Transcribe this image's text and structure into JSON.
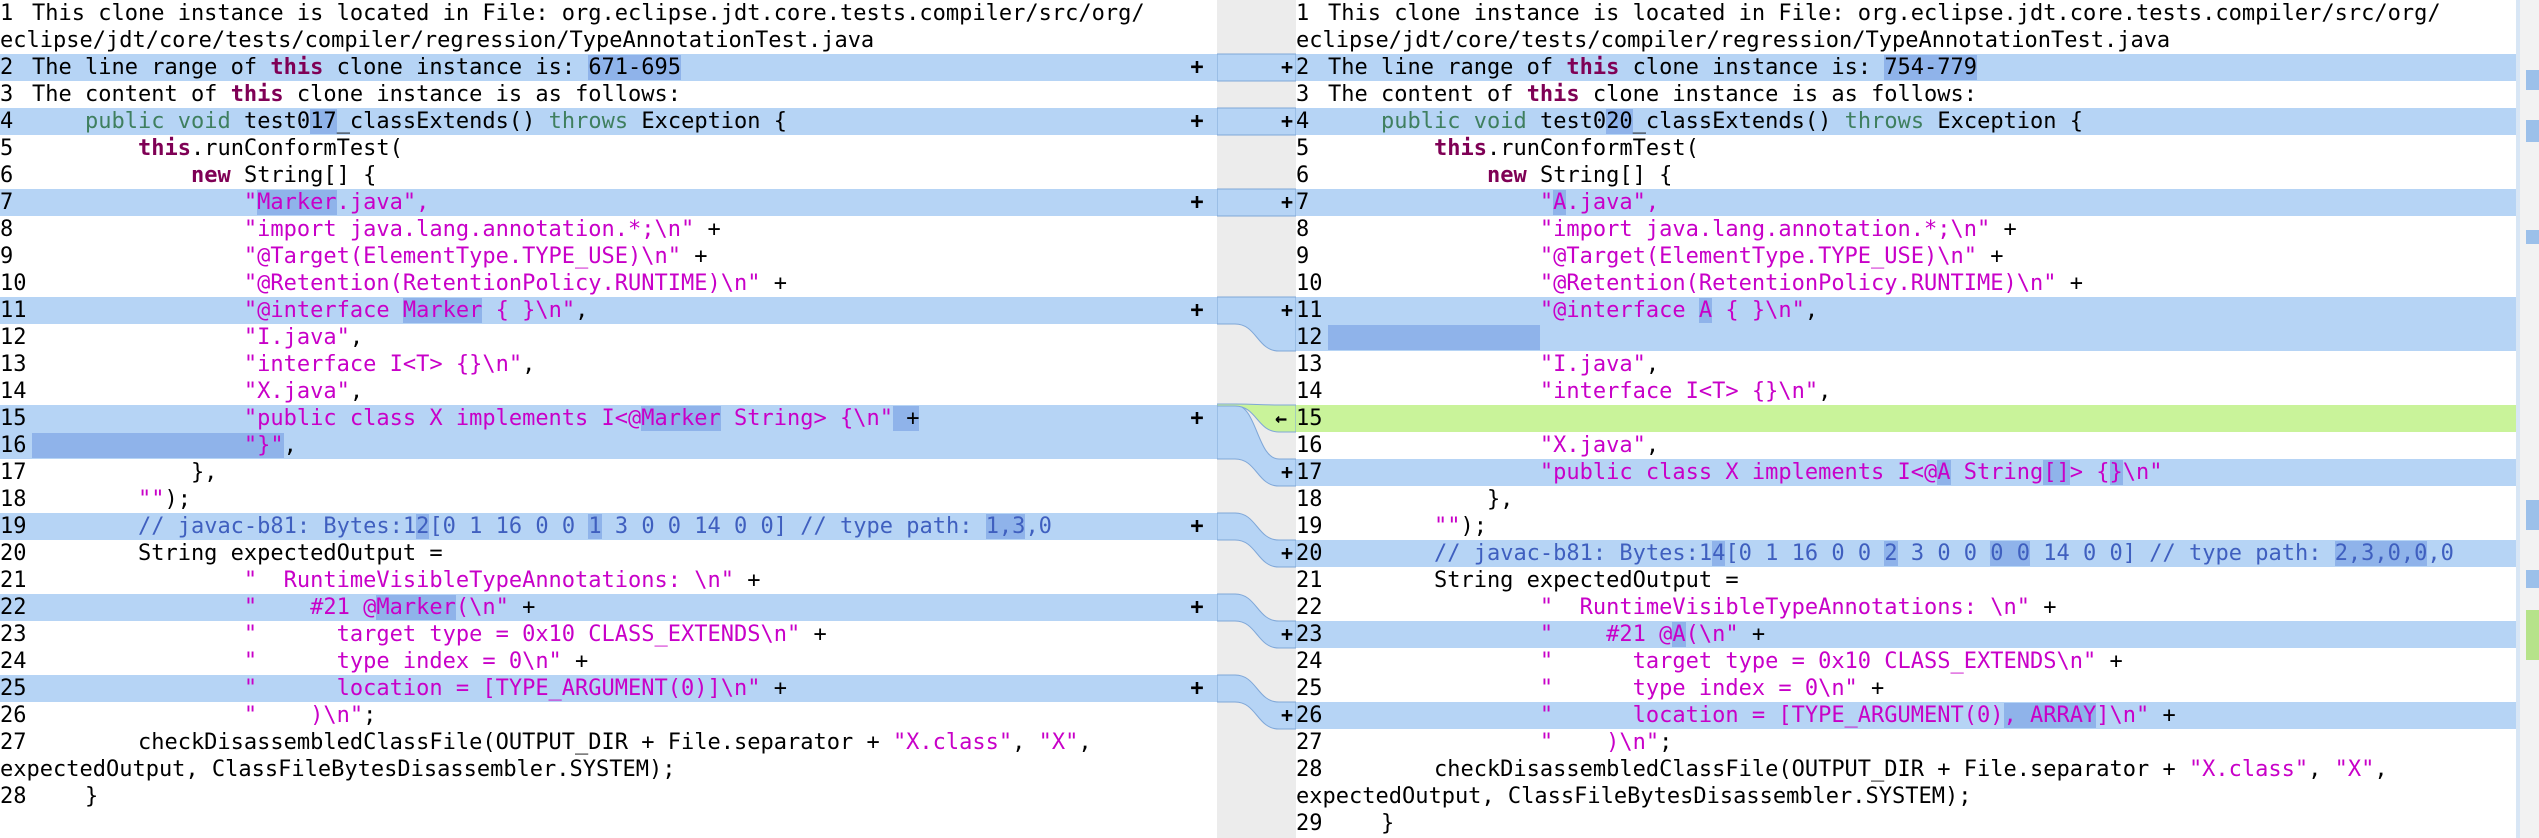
{
  "left": {
    "lines": [
      {
        "n": "1",
        "parts": [
          {
            "t": "This clone instance is located in File: org.eclipse.jdt.core.tests.compiler/src/org/"
          }
        ],
        "wrap": [
          {
            "t": "eclipse/jdt/core/tests/compiler/regression/TypeAnnotationTest.java"
          }
        ]
      },
      {
        "n": "2",
        "hl": true,
        "parts": [
          {
            "t": "The line range of "
          },
          {
            "t": "this",
            "c": "kw"
          },
          {
            "t": " clone instance is: "
          },
          {
            "t": "671-695",
            "c": "dh"
          }
        ]
      },
      {
        "n": "3",
        "parts": [
          {
            "t": "The content of "
          },
          {
            "t": "this",
            "c": "kw"
          },
          {
            "t": " clone instance is as follows:"
          }
        ]
      },
      {
        "n": "4",
        "hl": true,
        "parts": [
          {
            "t": "    "
          },
          {
            "t": "public",
            "c": "kg"
          },
          {
            "t": " "
          },
          {
            "t": "void",
            "c": "kg"
          },
          {
            "t": " test0"
          },
          {
            "t": "17",
            "c": "dh"
          },
          {
            "t": "_classExtends() "
          },
          {
            "t": "throws",
            "c": "kg"
          },
          {
            "t": " Exception {"
          }
        ]
      },
      {
        "n": "5",
        "parts": [
          {
            "t": "        "
          },
          {
            "t": "this",
            "c": "kw"
          },
          {
            "t": ".runConformTest("
          }
        ]
      },
      {
        "n": "6",
        "parts": [
          {
            "t": "            "
          },
          {
            "t": "new",
            "c": "kw"
          },
          {
            "t": " String[] {"
          }
        ]
      },
      {
        "n": "7",
        "hl": true,
        "parts": [
          {
            "t": "                "
          },
          {
            "t": "\"",
            "c": "str"
          },
          {
            "t": "Marker",
            "c": "str dh"
          },
          {
            "t": ".java\",",
            "c": "str"
          }
        ]
      },
      {
        "n": "8",
        "parts": [
          {
            "t": "                "
          },
          {
            "t": "\"import java.lang.annotation.*;\\n\"",
            "c": "str"
          },
          {
            "t": " +"
          }
        ]
      },
      {
        "n": "9",
        "parts": [
          {
            "t": "                "
          },
          {
            "t": "\"@Target(ElementType.TYPE_USE)\\n\"",
            "c": "str"
          },
          {
            "t": " +"
          }
        ]
      },
      {
        "n": "10",
        "parts": [
          {
            "t": "                "
          },
          {
            "t": "\"@Retention(RetentionPolicy.RUNTIME)\\n\"",
            "c": "str"
          },
          {
            "t": " +"
          }
        ]
      },
      {
        "n": "11",
        "hl": true,
        "parts": [
          {
            "t": "                "
          },
          {
            "t": "\"@interface ",
            "c": "str"
          },
          {
            "t": "Marker",
            "c": "str dh"
          },
          {
            "t": " { }\\n\"",
            "c": "str"
          },
          {
            "t": ","
          }
        ]
      },
      {
        "n": "12",
        "parts": [
          {
            "t": "                "
          },
          {
            "t": "\"I.java\"",
            "c": "str"
          },
          {
            "t": ","
          }
        ]
      },
      {
        "n": "13",
        "parts": [
          {
            "t": "                "
          },
          {
            "t": "\"interface I<T> {}\\n\"",
            "c": "str"
          },
          {
            "t": ","
          }
        ]
      },
      {
        "n": "14",
        "parts": [
          {
            "t": "                "
          },
          {
            "t": "\"X.java\"",
            "c": "str"
          },
          {
            "t": ","
          }
        ]
      },
      {
        "n": "15",
        "hl": true,
        "parts": [
          {
            "t": "                "
          },
          {
            "t": "\"public class X implements I<@",
            "c": "str"
          },
          {
            "t": "Marker",
            "c": "str dh"
          },
          {
            "t": " String> {\\n\"",
            "c": "str"
          },
          {
            "t": " +",
            "c": "dh"
          }
        ]
      },
      {
        "n": "16",
        "hl": true,
        "parts": [
          {
            "t": "                ",
            "c": "dh"
          },
          {
            "t": "\"}\"",
            "c": "str dh"
          },
          {
            "t": ","
          }
        ]
      },
      {
        "n": "17",
        "parts": [
          {
            "t": "            },"
          }
        ]
      },
      {
        "n": "18",
        "parts": [
          {
            "t": "        "
          },
          {
            "t": "\"\"",
            "c": "str"
          },
          {
            "t": ");"
          }
        ]
      },
      {
        "n": "19",
        "hl": true,
        "parts": [
          {
            "t": "        "
          },
          {
            "t": "// javac-b81: Bytes:1",
            "c": "cm"
          },
          {
            "t": "2",
            "c": "cm dh"
          },
          {
            "t": "[0 1 16 0 0 ",
            "c": "cm"
          },
          {
            "t": "1",
            "c": "cm dh"
          },
          {
            "t": " 3 0 0 14 0 0] // type path: ",
            "c": "cm"
          },
          {
            "t": "1,3",
            "c": "cm dh"
          },
          {
            "t": ",0",
            "c": "cm"
          }
        ]
      },
      {
        "n": "20",
        "parts": [
          {
            "t": "        String expectedOutput ="
          }
        ]
      },
      {
        "n": "21",
        "parts": [
          {
            "t": "                "
          },
          {
            "t": "\"  RuntimeVisibleTypeAnnotations: \\n\"",
            "c": "str"
          },
          {
            "t": " +"
          }
        ]
      },
      {
        "n": "22",
        "hl": true,
        "parts": [
          {
            "t": "                "
          },
          {
            "t": "\"    #21 @",
            "c": "str"
          },
          {
            "t": "Marker",
            "c": "str dh"
          },
          {
            "t": "(\\n\"",
            "c": "str"
          },
          {
            "t": " +"
          }
        ]
      },
      {
        "n": "23",
        "parts": [
          {
            "t": "                "
          },
          {
            "t": "\"      target type = 0x10 CLASS_EXTENDS\\n\"",
            "c": "str"
          },
          {
            "t": " +"
          }
        ]
      },
      {
        "n": "24",
        "parts": [
          {
            "t": "                "
          },
          {
            "t": "\"      type index = 0\\n\"",
            "c": "str"
          },
          {
            "t": " +"
          }
        ]
      },
      {
        "n": "25",
        "hl": true,
        "parts": [
          {
            "t": "                "
          },
          {
            "t": "\"      location = [TYPE_ARGUMENT(0)]\\n\"",
            "c": "str"
          },
          {
            "t": " +"
          }
        ]
      },
      {
        "n": "26",
        "parts": [
          {
            "t": "                "
          },
          {
            "t": "\"    )\\n\"",
            "c": "str"
          },
          {
            "t": ";"
          }
        ]
      },
      {
        "n": "27",
        "parts": [
          {
            "t": "        checkDisassembledClassFile(OUTPUT_DIR + File.separator + "
          },
          {
            "t": "\"X.class\"",
            "c": "str"
          },
          {
            "t": ", "
          },
          {
            "t": "\"X\"",
            "c": "str"
          },
          {
            "t": ","
          }
        ],
        "wrap": [
          {
            "t": "expectedOutput, ClassFileBytesDisassembler.SYSTEM);"
          }
        ]
      },
      {
        "n": "28",
        "parts": [
          {
            "t": "    }"
          }
        ]
      }
    ]
  },
  "right": {
    "lines": [
      {
        "n": "1",
        "parts": [
          {
            "t": "This clone instance is located in File: org.eclipse.jdt.core.tests.compiler/src/org/"
          }
        ],
        "wrap": [
          {
            "t": "eclipse/jdt/core/tests/compiler/regression/TypeAnnotationTest.java"
          }
        ]
      },
      {
        "n": "2",
        "hl": true,
        "parts": [
          {
            "t": "The line range of "
          },
          {
            "t": "this",
            "c": "kw"
          },
          {
            "t": " clone instance is: "
          },
          {
            "t": "754-779",
            "c": "dh"
          }
        ]
      },
      {
        "n": "3",
        "parts": [
          {
            "t": "The content of "
          },
          {
            "t": "this",
            "c": "kw"
          },
          {
            "t": " clone instance is as follows:"
          }
        ]
      },
      {
        "n": "4",
        "hl": true,
        "parts": [
          {
            "t": "    "
          },
          {
            "t": "public",
            "c": "kg"
          },
          {
            "t": " "
          },
          {
            "t": "void",
            "c": "kg"
          },
          {
            "t": " test0"
          },
          {
            "t": "20",
            "c": "dh"
          },
          {
            "t": "_classExtends() "
          },
          {
            "t": "throws",
            "c": "kg"
          },
          {
            "t": " Exception {"
          }
        ]
      },
      {
        "n": "5",
        "parts": [
          {
            "t": "        "
          },
          {
            "t": "this",
            "c": "kw"
          },
          {
            "t": ".runConformTest("
          }
        ]
      },
      {
        "n": "6",
        "parts": [
          {
            "t": "            "
          },
          {
            "t": "new",
            "c": "kw"
          },
          {
            "t": " String[] {"
          }
        ]
      },
      {
        "n": "7",
        "hl": true,
        "parts": [
          {
            "t": "                "
          },
          {
            "t": "\"",
            "c": "str"
          },
          {
            "t": "A",
            "c": "str dh"
          },
          {
            "t": ".java\",",
            "c": "str"
          }
        ]
      },
      {
        "n": "8",
        "parts": [
          {
            "t": "                "
          },
          {
            "t": "\"import java.lang.annotation.*;\\n\"",
            "c": "str"
          },
          {
            "t": " +"
          }
        ]
      },
      {
        "n": "9",
        "parts": [
          {
            "t": "                "
          },
          {
            "t": "\"@Target(ElementType.TYPE_USE)\\n\"",
            "c": "str"
          },
          {
            "t": " +"
          }
        ]
      },
      {
        "n": "10",
        "parts": [
          {
            "t": "                "
          },
          {
            "t": "\"@Retention(RetentionPolicy.RUNTIME)\\n\"",
            "c": "str"
          },
          {
            "t": " +"
          }
        ]
      },
      {
        "n": "11",
        "hl": true,
        "parts": [
          {
            "t": "                "
          },
          {
            "t": "\"@interface ",
            "c": "str"
          },
          {
            "t": "A",
            "c": "str dh"
          },
          {
            "t": " { }\\n\"",
            "c": "str"
          },
          {
            "t": ","
          }
        ]
      },
      {
        "n": "12",
        "hl": true,
        "parts": [
          {
            "t": "                ",
            "c": "dh"
          }
        ]
      },
      {
        "n": "13",
        "parts": [
          {
            "t": "                "
          },
          {
            "t": "\"I.java\"",
            "c": "str"
          },
          {
            "t": ","
          }
        ]
      },
      {
        "n": "14",
        "parts": [
          {
            "t": "                "
          },
          {
            "t": "\"interface I<T> {}\\n\"",
            "c": "str"
          },
          {
            "t": ","
          }
        ]
      },
      {
        "n": "15",
        "add": true,
        "parts": [
          {
            "t": ""
          }
        ]
      },
      {
        "n": "16",
        "parts": [
          {
            "t": "                "
          },
          {
            "t": "\"X.java\"",
            "c": "str"
          },
          {
            "t": ","
          }
        ]
      },
      {
        "n": "17",
        "hl": true,
        "parts": [
          {
            "t": "                "
          },
          {
            "t": "\"public class X implements I<@",
            "c": "str"
          },
          {
            "t": "A",
            "c": "str dh"
          },
          {
            "t": " String",
            "c": "str"
          },
          {
            "t": "[]",
            "c": "str dh"
          },
          {
            "t": "> {",
            "c": "str"
          },
          {
            "t": "}",
            "c": "str dh"
          },
          {
            "t": "\\n\"",
            "c": "str"
          }
        ]
      },
      {
        "n": "18",
        "parts": [
          {
            "t": "            },"
          }
        ]
      },
      {
        "n": "19",
        "parts": [
          {
            "t": "        "
          },
          {
            "t": "\"\"",
            "c": "str"
          },
          {
            "t": ");"
          }
        ]
      },
      {
        "n": "20",
        "hl": true,
        "parts": [
          {
            "t": "        "
          },
          {
            "t": "// javac-b81: Bytes:1",
            "c": "cm"
          },
          {
            "t": "4",
            "c": "cm dh"
          },
          {
            "t": "[0 1 16 0 0 ",
            "c": "cm"
          },
          {
            "t": "2",
            "c": "cm dh"
          },
          {
            "t": " 3 0 0 ",
            "c": "cm"
          },
          {
            "t": "0 0",
            "c": "cm dh"
          },
          {
            "t": " 14 0 0] // type path: ",
            "c": "cm"
          },
          {
            "t": "2,3,0,0",
            "c": "cm dh"
          },
          {
            "t": ",0",
            "c": "cm"
          }
        ]
      },
      {
        "n": "21",
        "parts": [
          {
            "t": "        String expectedOutput ="
          }
        ]
      },
      {
        "n": "22",
        "parts": [
          {
            "t": "                "
          },
          {
            "t": "\"  RuntimeVisibleTypeAnnotations: \\n\"",
            "c": "str"
          },
          {
            "t": " +"
          }
        ]
      },
      {
        "n": "23",
        "hl": true,
        "parts": [
          {
            "t": "                "
          },
          {
            "t": "\"    #21 @",
            "c": "str"
          },
          {
            "t": "A",
            "c": "str dh"
          },
          {
            "t": "(\\n\"",
            "c": "str"
          },
          {
            "t": " +"
          }
        ]
      },
      {
        "n": "24",
        "parts": [
          {
            "t": "                "
          },
          {
            "t": "\"      target type = 0x10 CLASS_EXTENDS\\n\"",
            "c": "str"
          },
          {
            "t": " +"
          }
        ]
      },
      {
        "n": "25",
        "parts": [
          {
            "t": "                "
          },
          {
            "t": "\"      type index = 0\\n\"",
            "c": "str"
          },
          {
            "t": " +"
          }
        ]
      },
      {
        "n": "26",
        "hl": true,
        "parts": [
          {
            "t": "                "
          },
          {
            "t": "\"      location = [TYPE_ARGUMENT(0)",
            "c": "str"
          },
          {
            "t": ", ARRAY",
            "c": "str dh"
          },
          {
            "t": "]\\n\"",
            "c": "str"
          },
          {
            "t": " +"
          }
        ]
      },
      {
        "n": "27",
        "parts": [
          {
            "t": "                "
          },
          {
            "t": "\"    )\\n\"",
            "c": "str"
          },
          {
            "t": ";"
          }
        ]
      },
      {
        "n": "28",
        "parts": [
          {
            "t": "        checkDisassembledClassFile(OUTPUT_DIR + File.separator + "
          },
          {
            "t": "\"X.class\"",
            "c": "str"
          },
          {
            "t": ", "
          },
          {
            "t": "\"X\"",
            "c": "str"
          },
          {
            "t": ","
          }
        ],
        "wrap": [
          {
            "t": "expectedOutput, ClassFileBytesDisassembler.SYSTEM);"
          }
        ]
      },
      {
        "n": "29",
        "parts": [
          {
            "t": "    }"
          }
        ]
      }
    ]
  },
  "merge_glyphs": {
    "copy_right": "+",
    "copy_left": "+",
    "insert_left": "←"
  },
  "colors": {
    "changed": "#b6d4f5",
    "inline_diff": "#8fb3ea",
    "added": "#c9f39a",
    "keyword": "#7f0055",
    "string": "#c800c8",
    "comment": "#3f5fbf"
  }
}
